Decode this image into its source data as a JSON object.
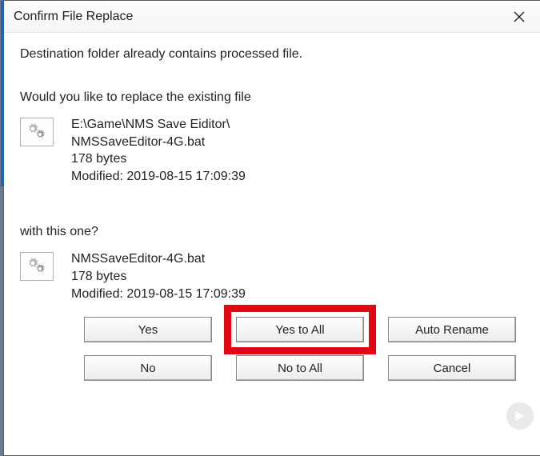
{
  "title": "Confirm File Replace",
  "messages": {
    "line1": "Destination folder already contains processed file.",
    "line2": "Would you like to replace the existing file",
    "line3": "with this one?"
  },
  "existing_file": {
    "path": "E:\\Game\\NMS Save Eiditor\\",
    "name": "NMSSaveEditor-4G.bat",
    "size": "178 bytes",
    "modified": "Modified: 2019-08-15 17:09:39"
  },
  "new_file": {
    "name": "NMSSaveEditor-4G.bat",
    "size": "178 bytes",
    "modified": "Modified: 2019-08-15 17:09:39"
  },
  "buttons": {
    "yes": "Yes",
    "yes_all": "Yes to All",
    "auto_rename": "Auto Rename",
    "no": "No",
    "no_all": "No to All",
    "cancel": "Cancel"
  },
  "icons": {
    "file": "gears-icon",
    "close": "close-icon"
  },
  "highlight": "yes_all"
}
